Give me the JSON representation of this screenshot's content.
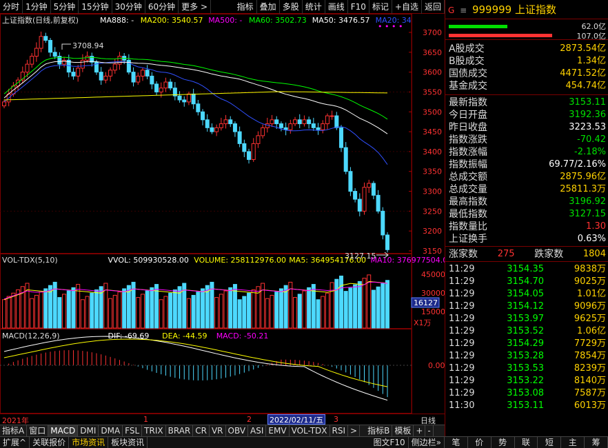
{
  "toolbar": {
    "left_items": [
      "分时",
      "1分钟",
      "5分钟",
      "15分钟",
      "30分钟",
      "60分钟",
      "更多 >"
    ],
    "right_items": [
      "指标",
      "叠加",
      "多股",
      "统计",
      "画线",
      "F10",
      "标记",
      "+自选",
      "返回"
    ]
  },
  "main_chart": {
    "title": "上证指数(日线,前复权)",
    "ma_labels": [
      {
        "text": "MA888: -",
        "color": "#ffffff"
      },
      {
        "text": "MA200: 3540.57",
        "color": "#ffff00"
      },
      {
        "text": "MA500: -",
        "color": "#ff00ff"
      },
      {
        "text": "MA60: 3502.73",
        "color": "#00ff00"
      },
      {
        "text": "MA50: 3476.57",
        "color": "#ffffff"
      },
      {
        "text": "MA20: 34",
        "color": "#3050ff"
      }
    ],
    "price_axis": [
      "3700",
      "3650",
      "3600",
      "3550",
      "3500",
      "3450",
      "3400",
      "3350",
      "3300",
      "3250",
      "3200",
      "3150"
    ],
    "high_label": "3708.94",
    "low_label": "3127.15"
  },
  "volume": {
    "title": "VOL-TDX(5,10)",
    "labels": [
      {
        "text": "VVOL: 509930528.00",
        "color": "#ffffff"
      },
      {
        "text": "VOLUME: 258112976.00",
        "color": "#ffff00"
      },
      {
        "text": "MA5: 364954176.00",
        "color": "#ffff00"
      },
      {
        "text": "MA10: 376977504.00",
        "color": "#ff00ff"
      }
    ],
    "axis": [
      "45000",
      "30000",
      "15000"
    ],
    "current_box": "16127",
    "unit": "X1万"
  },
  "macd": {
    "title": "MACD(12,26,9)",
    "labels": [
      {
        "text": "DIF: -69.69",
        "color": "#ffffff"
      },
      {
        "text": "DEA: -44.59",
        "color": "#ffff00"
      },
      {
        "text": "MACD: -50.21",
        "color": "#ff00ff"
      }
    ],
    "axis": [
      "0.00"
    ]
  },
  "time_axis": {
    "year": "2021年",
    "ticks": [
      "1",
      "2",
      "3"
    ],
    "highlight": "2022/02/11/五",
    "right_label": "日线"
  },
  "indicator_tabs": [
    "指标A",
    "窗口",
    "MACD",
    "DMI",
    "DMA",
    "FSL",
    "TRIX",
    "BRAR",
    "CR",
    "VR",
    "OBV",
    "ASI",
    "EMV",
    "VOL-TDX",
    "RSI",
    ">",
    "指标B",
    "模板",
    "+",
    "-"
  ],
  "bottom_tabs": [
    "扩展^",
    "关联报价",
    "市场资讯",
    "板块资讯"
  ],
  "bottom_right_tabs": [
    "图文F10",
    "侧边栏»"
  ],
  "right_panel": {
    "header_code": "999999",
    "header_name": "上证指数",
    "bars": [
      {
        "value": "62.0亿",
        "color": "#00e000"
      },
      {
        "value": "107.0亿",
        "color": "#ff3232"
      }
    ],
    "turnover": [
      {
        "k": "A股成交",
        "v": "2873.54亿"
      },
      {
        "k": "B股成交",
        "v": "1.34亿"
      },
      {
        "k": "国债成交",
        "v": "4471.52亿"
      },
      {
        "k": "基金成交",
        "v": "454.74亿"
      }
    ],
    "stats": [
      {
        "k": "最新指数",
        "v": "3153.11",
        "c": "green"
      },
      {
        "k": "今日开盘",
        "v": "3192.36",
        "c": "green"
      },
      {
        "k": "昨日收盘",
        "v": "3223.53",
        "c": "white"
      },
      {
        "k": "指数涨跌",
        "v": "-70.42",
        "c": "green"
      },
      {
        "k": "指数涨幅",
        "v": "-2.18%",
        "c": "green"
      },
      {
        "k": "指数振幅",
        "v": "69.77/2.16%",
        "c": "white"
      },
      {
        "k": "总成交额",
        "v": "2875.96亿",
        "c": "yellow"
      },
      {
        "k": "总成交量",
        "v": "25811.3万",
        "c": "yellow"
      },
      {
        "k": "最高指数",
        "v": "3196.92",
        "c": "green"
      },
      {
        "k": "最低指数",
        "v": "3127.15",
        "c": "green"
      },
      {
        "k": "指数量比",
        "v": "1.30",
        "c": "red"
      },
      {
        "k": "上证换手",
        "v": "0.63%",
        "c": "white"
      }
    ],
    "rise_label": "涨家数",
    "rise_value": "275",
    "fall_label": "跌家数",
    "fall_value": "1804",
    "ticks": [
      {
        "t": "11:29",
        "p": "3154.35",
        "v": "9838万"
      },
      {
        "t": "11:29",
        "p": "3154.70",
        "v": "9025万"
      },
      {
        "t": "11:29",
        "p": "3154.05",
        "v": "1.01亿"
      },
      {
        "t": "11:29",
        "p": "3154.12",
        "v": "9096万"
      },
      {
        "t": "11:29",
        "p": "3153.97",
        "v": "9625万"
      },
      {
        "t": "11:29",
        "p": "3153.52",
        "v": "1.06亿"
      },
      {
        "t": "11:29",
        "p": "3154.29",
        "v": "7729万"
      },
      {
        "t": "11:29",
        "p": "3153.28",
        "v": "7854万"
      },
      {
        "t": "11:29",
        "p": "3153.53",
        "v": "8239万"
      },
      {
        "t": "11:29",
        "p": "3153.22",
        "v": "8140万"
      },
      {
        "t": "11:29",
        "p": "3153.08",
        "v": "7587万"
      },
      {
        "t": "11:30",
        "p": "3153.11",
        "v": "6013万"
      }
    ],
    "bottom_tabs": [
      "笔",
      "价",
      "势",
      "联",
      "短",
      "主",
      "筹"
    ]
  }
}
